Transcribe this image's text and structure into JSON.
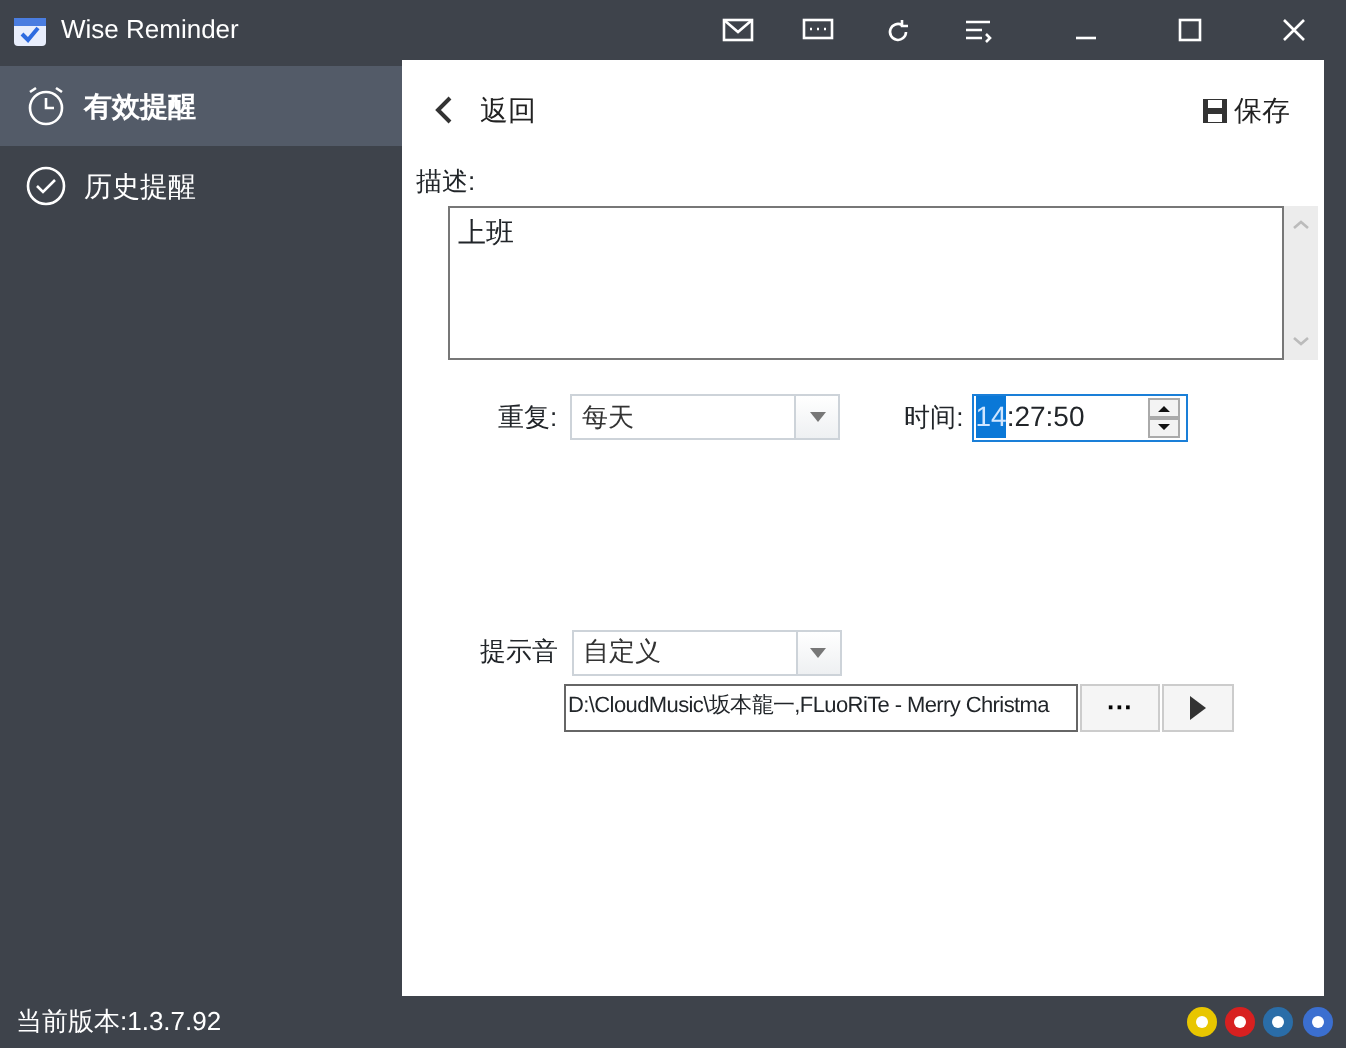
{
  "window": {
    "title": "Wise Reminder"
  },
  "sidebar": {
    "items": [
      {
        "label": "有效提醒",
        "selected": true,
        "kind": "alarm"
      },
      {
        "label": "历史提醒",
        "selected": false,
        "kind": "check"
      }
    ]
  },
  "header": {
    "back": "返回",
    "save": "保存"
  },
  "form": {
    "description_label": "描述:",
    "description": "上班",
    "repeat_label": "重复:",
    "repeat": "每天",
    "time_label": "时间:",
    "time_hours": "14",
    "time_rest": ":27:50",
    "sound_label": "提示音",
    "sound": "自定义",
    "sound_path": "D:\\CloudMusic\\坂本龍一,FLuoRiTe - Merry Christma",
    "browse": "···"
  },
  "status_bar": {
    "version": "当前版本:1.3.7.92"
  }
}
